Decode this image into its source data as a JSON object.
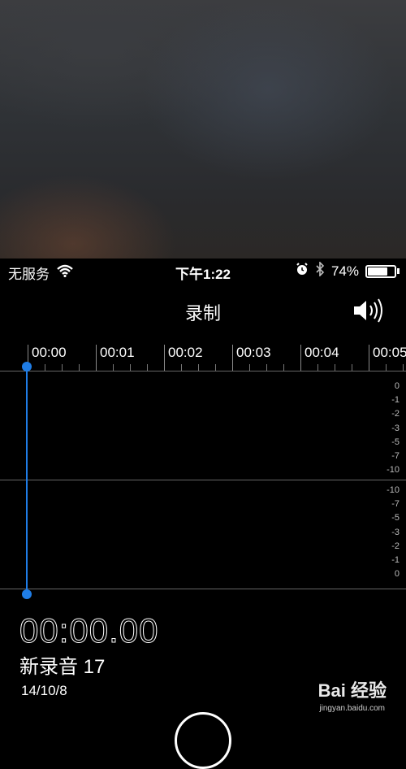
{
  "status": {
    "carrier": "无服务",
    "time": "下午1:22",
    "battery_percent": "74%",
    "battery_level": 0.74
  },
  "nav": {
    "title": "录制"
  },
  "timeline": {
    "labels": [
      "00:00",
      "00:01",
      "00:02",
      "00:03",
      "00:04",
      "00:05"
    ]
  },
  "db_scale": {
    "upper": [
      "0",
      "-1",
      "-2",
      "-3",
      "-5",
      "-7",
      "-10"
    ],
    "lower": [
      "-10",
      "-7",
      "-5",
      "-3",
      "-2",
      "-1",
      "0"
    ]
  },
  "recording": {
    "elapsed": "00:00.00",
    "name": "新录音 17",
    "date": "14/10/8"
  },
  "watermark": {
    "brand": "Bai 经验",
    "url": "jingyan.baidu.com"
  },
  "colors": {
    "accent": "#1f7de6"
  }
}
